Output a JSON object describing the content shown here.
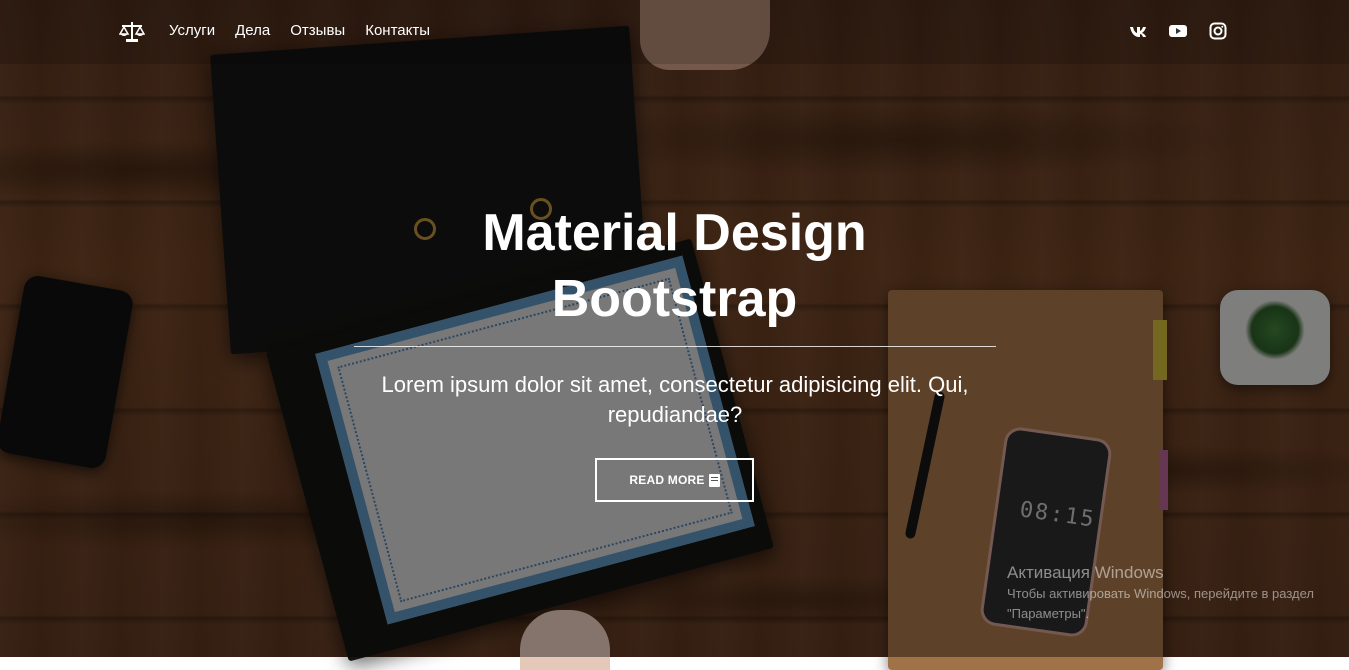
{
  "navbar": {
    "brand_icon": "scales-icon",
    "links": [
      "Услуги",
      "Дела",
      "Отзывы",
      "Контакты"
    ],
    "social": [
      "vk-icon",
      "youtube-icon",
      "instagram-icon"
    ]
  },
  "hero": {
    "title_line1": "Material Design",
    "title_line2": "Bootstrap",
    "text": "Lorem ipsum dolor sit amet, consectetur adipisicing elit. Qui, repudiandae?",
    "button_label": "READ MORE",
    "button_icon": "book-icon"
  },
  "background": {
    "phone_clock": "08:15"
  },
  "watermark": {
    "title": "Активация Windows",
    "text": "Чтобы активировать Windows, перейдите в раздел \"Параметры\"."
  }
}
